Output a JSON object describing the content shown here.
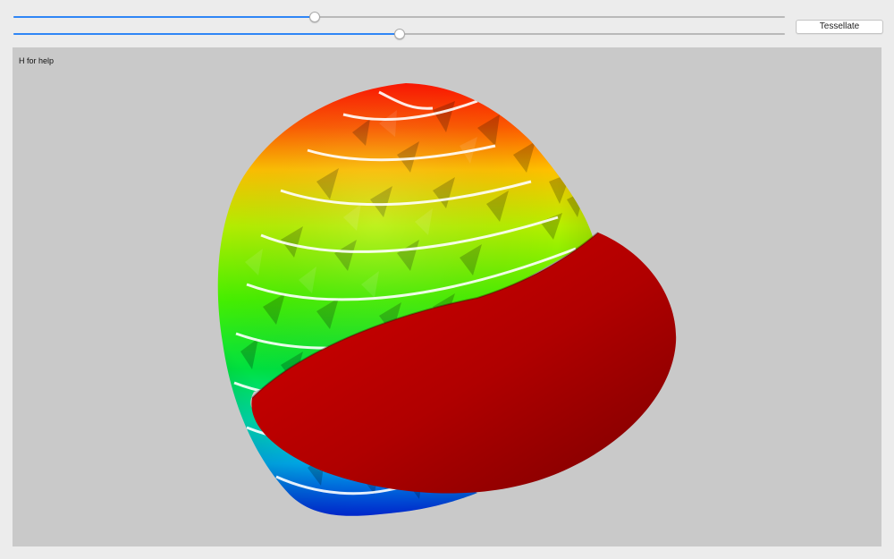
{
  "controls": {
    "slider1": {
      "value": 0.39
    },
    "slider2": {
      "value": 0.5
    },
    "tessellate_label": "Tessellate"
  },
  "viewport": {
    "help_text": "H for help"
  },
  "colors": {
    "accent": "#2f86f6",
    "viewport_bg": "#c9c9c9",
    "window_bg": "#ececec",
    "cut_surface": "#cc0000"
  }
}
